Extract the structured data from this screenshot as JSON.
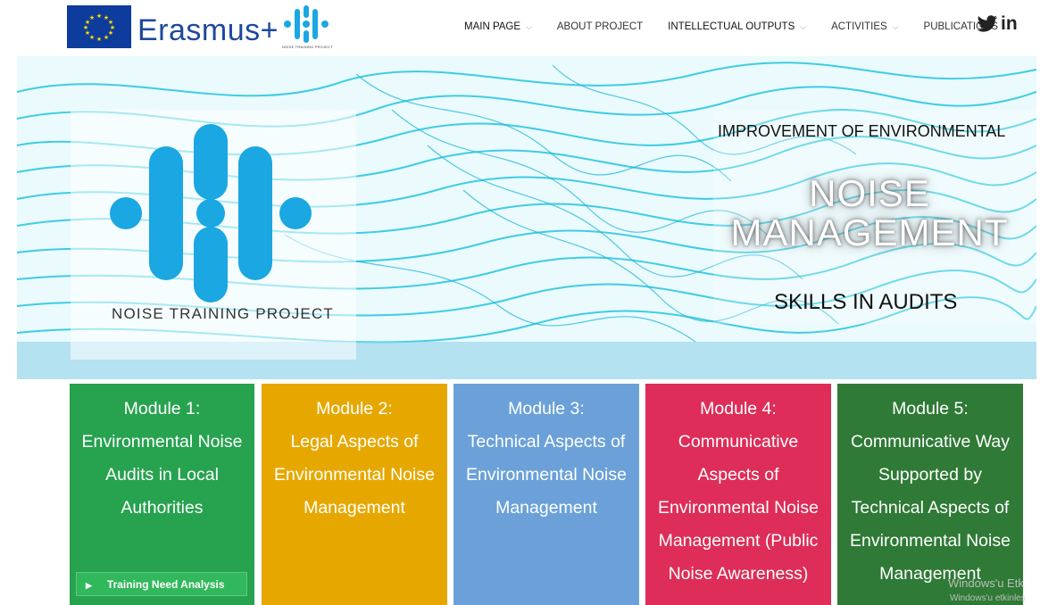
{
  "header": {
    "brand": "Erasmus+",
    "logo_caption": "NOISE TRAINING PROJECT",
    "nav": [
      {
        "label": "MAIN PAGE",
        "has_dropdown": true
      },
      {
        "label": "ABOUT PROJECT",
        "has_dropdown": false
      },
      {
        "label": "INTELLECTUAL OUTPUTS",
        "has_dropdown": true
      },
      {
        "label": "ACTIVITIES",
        "has_dropdown": true
      },
      {
        "label": "PUBLICATIONS",
        "has_dropdown": true
      }
    ],
    "social": {
      "twitter": "twitter-icon",
      "linkedin": "in"
    }
  },
  "hero": {
    "logo_caption": "NOISE TRAINING PROJECT",
    "line1": "IMPROVEMENT OF ENVIRONMENTAL",
    "line2a": "NOISE",
    "line2b": "MANAGEMENT",
    "line3": "SKILLS IN AUDITS"
  },
  "modules": [
    {
      "title": "Module 1:",
      "text": [
        "Environmental Noise",
        "Audits in Local",
        "Authorities"
      ],
      "color": "#27a24f"
    },
    {
      "title": "Module 2:",
      "text": [
        "Legal Aspects of",
        "Environmental Noise",
        "Management"
      ],
      "color": "#e6a800"
    },
    {
      "title": "Module 3:",
      "text": [
        "Technical Aspects of",
        "Environmental Noise",
        "Management"
      ],
      "color": "#6ba1d8"
    },
    {
      "title": "Module 4:",
      "text": [
        "Communicative",
        "Aspects of",
        "Environmental Noise",
        "Management (Public",
        "Noise Awareness)"
      ],
      "color": "#dd2d58"
    },
    {
      "title": "Module 5:",
      "text": [
        "Communicative Way",
        "Supported by",
        "Technical Aspects of",
        "Environmental Noise",
        "Management"
      ],
      "color": "#2f7a36"
    }
  ],
  "training_button": "Training Need Analysis",
  "watermark": {
    "line1": "Windows'u Etk",
    "line2": "Windows'u etkinleş"
  },
  "colors": {
    "accent": "#1aa7e2",
    "brand_blue": "#1e4a9b"
  }
}
